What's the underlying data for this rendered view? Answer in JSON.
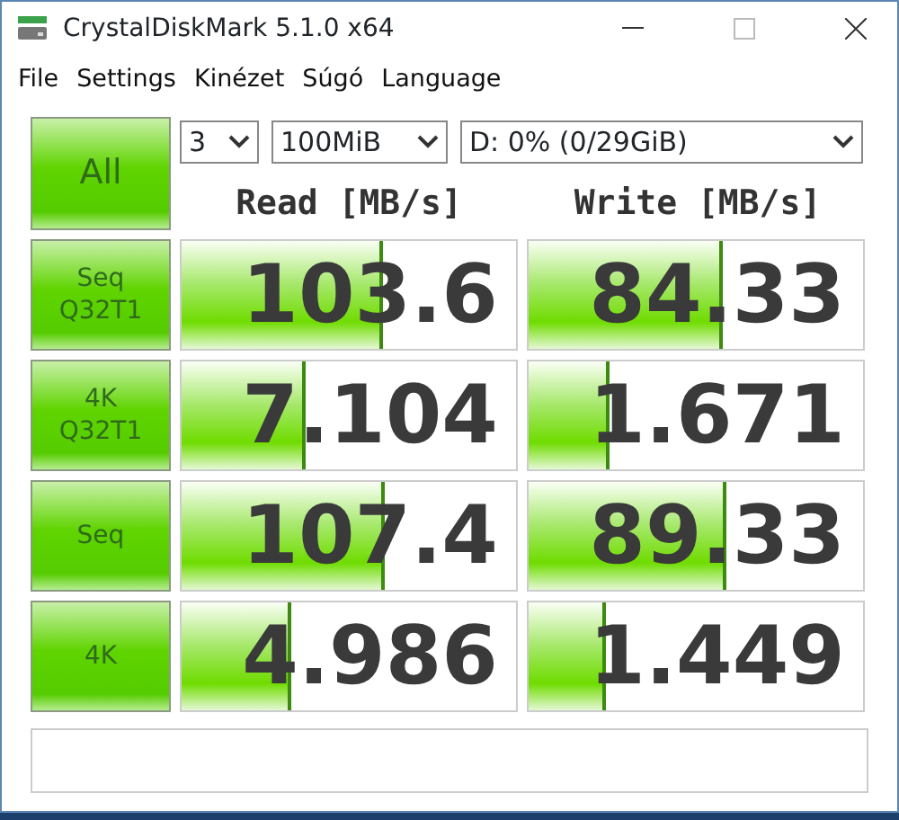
{
  "window": {
    "title": "CrystalDiskMark 5.1.0 x64"
  },
  "menu": [
    "File",
    "Settings",
    "Kinézet",
    "Súgó",
    "Language"
  ],
  "all_button": "All",
  "selectors": [
    {
      "value": "3"
    },
    {
      "value": "100MiB"
    },
    {
      "value": "D: 0% (0/29GiB)"
    }
  ],
  "headers": [
    "Read [MB/s]",
    "Write [MB/s]"
  ],
  "tests": [
    {
      "label": "Seq\nQ32T1",
      "read": {
        "value": "103.6",
        "level": 0.6
      },
      "write": {
        "value": "84.33",
        "level": 0.58
      }
    },
    {
      "label": "4K\nQ32T1",
      "read": {
        "value": "7.104",
        "level": 0.37
      },
      "write": {
        "value": "1.671",
        "level": 0.24
      }
    },
    {
      "label": "Seq",
      "read": {
        "value": "107.4",
        "level": 0.61
      },
      "write": {
        "value": "89.33",
        "level": 0.59
      }
    },
    {
      "label": "4K",
      "read": {
        "value": "4.986",
        "level": 0.33
      },
      "write": {
        "value": "1.449",
        "level": 0.23
      }
    }
  ]
}
